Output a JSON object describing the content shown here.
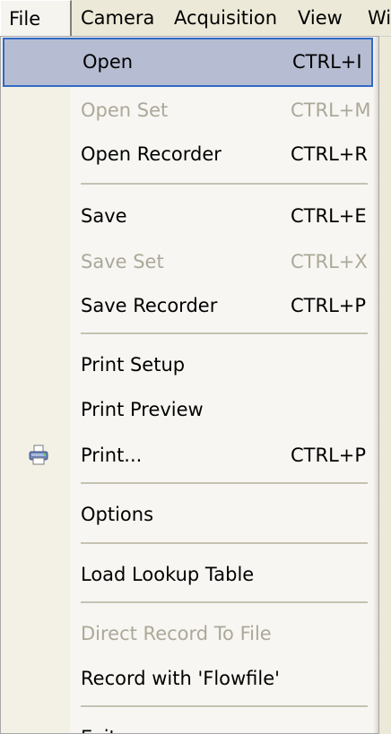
{
  "menubar": {
    "items": [
      "File",
      "Camera",
      "Acquisition",
      "View",
      "Wi"
    ]
  },
  "file_menu": {
    "items": [
      {
        "label": "Open",
        "shortcut": "CTRL+I",
        "state": "highlighted"
      },
      {
        "label": "Open Set",
        "shortcut": "CTRL+M",
        "state": "disabled"
      },
      {
        "label": "Open Recorder",
        "shortcut": "CTRL+R",
        "state": "enabled"
      },
      {
        "label": "Save",
        "shortcut": "CTRL+E",
        "state": "enabled"
      },
      {
        "label": "Save Set",
        "shortcut": "CTRL+X",
        "state": "disabled"
      },
      {
        "label": "Save Recorder",
        "shortcut": "CTRL+P",
        "state": "enabled"
      },
      {
        "label": "Print Setup",
        "shortcut": "",
        "state": "enabled"
      },
      {
        "label": "Print Preview",
        "shortcut": "",
        "state": "enabled"
      },
      {
        "label": "Print...",
        "shortcut": "CTRL+P",
        "state": "enabled",
        "icon": "printer-icon"
      },
      {
        "label": "Options",
        "shortcut": "",
        "state": "enabled"
      },
      {
        "label": "Load Lookup Table",
        "shortcut": "",
        "state": "enabled"
      },
      {
        "label": "Direct Record To File",
        "shortcut": "",
        "state": "disabled"
      },
      {
        "label": "Record with 'Flowfile'",
        "shortcut": "",
        "state": "enabled"
      },
      {
        "label": "Exit",
        "shortcut": "",
        "state": "enabled"
      }
    ]
  },
  "colors": {
    "highlight_fill": "#b6bdd2",
    "highlight_border": "#316ac5",
    "disabled_text": "#aca899",
    "menu_background": "#f7f6f2"
  }
}
